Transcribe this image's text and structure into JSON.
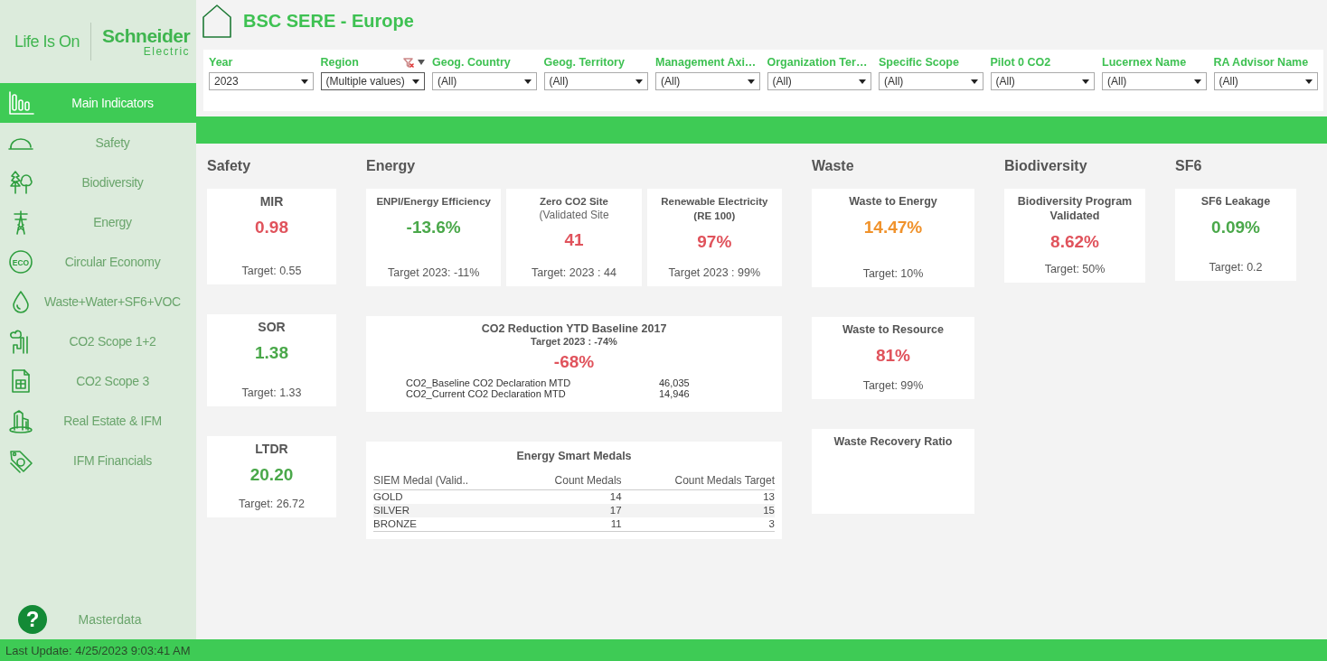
{
  "brand": {
    "tagline": "Life Is On",
    "name": "Schneider",
    "sub": "Electric"
  },
  "sidebar": {
    "items": [
      {
        "label": "Main Indicators",
        "selected": true
      },
      {
        "label": "Safety",
        "selected": false
      },
      {
        "label": "Biodiversity",
        "selected": false
      },
      {
        "label": "Energy",
        "selected": false
      },
      {
        "label": "Circular Economy",
        "selected": false,
        "icon_text": "ECO"
      },
      {
        "label": "Waste+Water+SF6+VOC",
        "selected": false
      },
      {
        "label": "CO2 Scope 1+2",
        "selected": false
      },
      {
        "label": "CO2 Scope 3",
        "selected": false
      },
      {
        "label": "Real Estate & IFM",
        "selected": false
      },
      {
        "label": "IFM Financials",
        "selected": false
      }
    ],
    "footer_item": {
      "label": "Masterdata",
      "icon_text": "?"
    }
  },
  "header": {
    "title": "BSC SERE - Europe"
  },
  "filters": [
    {
      "label": "Year",
      "value": "2023",
      "filtered": false
    },
    {
      "label": "Region",
      "value": "(Multiple values)",
      "filtered": true
    },
    {
      "label": "Geog. Country",
      "value": "(All)",
      "filtered": false
    },
    {
      "label": "Geog. Territory",
      "value": "(All)",
      "filtered": false
    },
    {
      "label": "Management Axi…",
      "value": "(All)",
      "filtered": false
    },
    {
      "label": "Organization Ter…",
      "value": "(All)",
      "filtered": false
    },
    {
      "label": "Specific Scope",
      "value": "(All)",
      "filtered": false
    },
    {
      "label": "Pilot 0 CO2",
      "value": "(All)",
      "filtered": false
    },
    {
      "label": "Lucernex Name",
      "value": "(All)",
      "filtered": false
    },
    {
      "label": "RA Advisor Name",
      "value": "(All)",
      "filtered": false
    }
  ],
  "sections": [
    {
      "title": "Safety",
      "cards": [
        {
          "kind": "kpi",
          "title": "MIR",
          "value": "0.98",
          "color": "#e0535c",
          "target": "Target: 0.55"
        },
        {
          "kind": "kpi",
          "title": "SOR",
          "value": "1.38",
          "color": "#4aa84a",
          "target": "Target: 1.33"
        },
        {
          "kind": "kpi",
          "title": "LTDR",
          "value": "20.20",
          "color": "#4aa84a",
          "target": "Target: 26.72"
        }
      ]
    },
    {
      "title": "Energy",
      "cards": [
        {
          "kind": "row",
          "cards": [
            {
              "kind": "kpi",
              "title": "ENPI/Energy Efficiency",
              "value": "-13.6%",
              "color": "#4aa84a",
              "target": "Target 2023: -11%"
            },
            {
              "kind": "kpi",
              "title": "Zero CO2 Site",
              "subtitle": "(Validated Site",
              "value": "41",
              "color": "#e0535c",
              "target": "Target: 2023 : 44"
            },
            {
              "kind": "kpi",
              "title": "Renewable Electricity (RE 100)",
              "value": "97%",
              "color": "#e0535c",
              "target": "Target 2023 : 99%"
            }
          ]
        },
        {
          "kind": "co2",
          "title": "CO2 Reduction YTD Baseline 2017",
          "subtitle": "Target 2023 : -74%",
          "value": "-68%",
          "color": "#e0535c",
          "rows": [
            {
              "label": "CO2_Baseline CO2 Declaration MTD",
              "value": "46,035"
            },
            {
              "label": "CO2_Current CO2  Declaration MTD",
              "value": "14,946"
            }
          ]
        },
        {
          "kind": "table",
          "title": "Energy Smart Medals",
          "columns": [
            "SIEM Medal (Valid..",
            "Count Medals",
            "Count Medals Target"
          ],
          "rows": [
            [
              "GOLD",
              "14",
              "13"
            ],
            [
              "SILVER",
              "17",
              "15"
            ],
            [
              "BRONZE",
              "11",
              "3"
            ]
          ]
        }
      ]
    },
    {
      "title": "Waste",
      "cards": [
        {
          "kind": "kpi",
          "title": "Waste to Energy",
          "value": "14.47%",
          "color": "#f0922b",
          "target": "Target: 10%"
        },
        {
          "kind": "kpi",
          "title": "Waste to Resource",
          "value": "81%",
          "color": "#e0535c",
          "target": "Target: 99%"
        },
        {
          "kind": "kpi",
          "title": "Waste Recovery Ratio"
        }
      ]
    },
    {
      "title": "Biodiversity",
      "cards": [
        {
          "kind": "kpi",
          "title": "Biodiversity Program Validated",
          "value": "8.62%",
          "color": "#e0535c",
          "target": "Target: 50%"
        }
      ]
    },
    {
      "title": "SF6",
      "cards": [
        {
          "kind": "kpi",
          "title": "SF6 Leakage",
          "value": "0.09%",
          "color": "#4aa84a",
          "target": "Target: 0.2"
        }
      ]
    }
  ],
  "status_bar": {
    "text": "Last Update: 4/25/2023 9:03:41 AM"
  }
}
